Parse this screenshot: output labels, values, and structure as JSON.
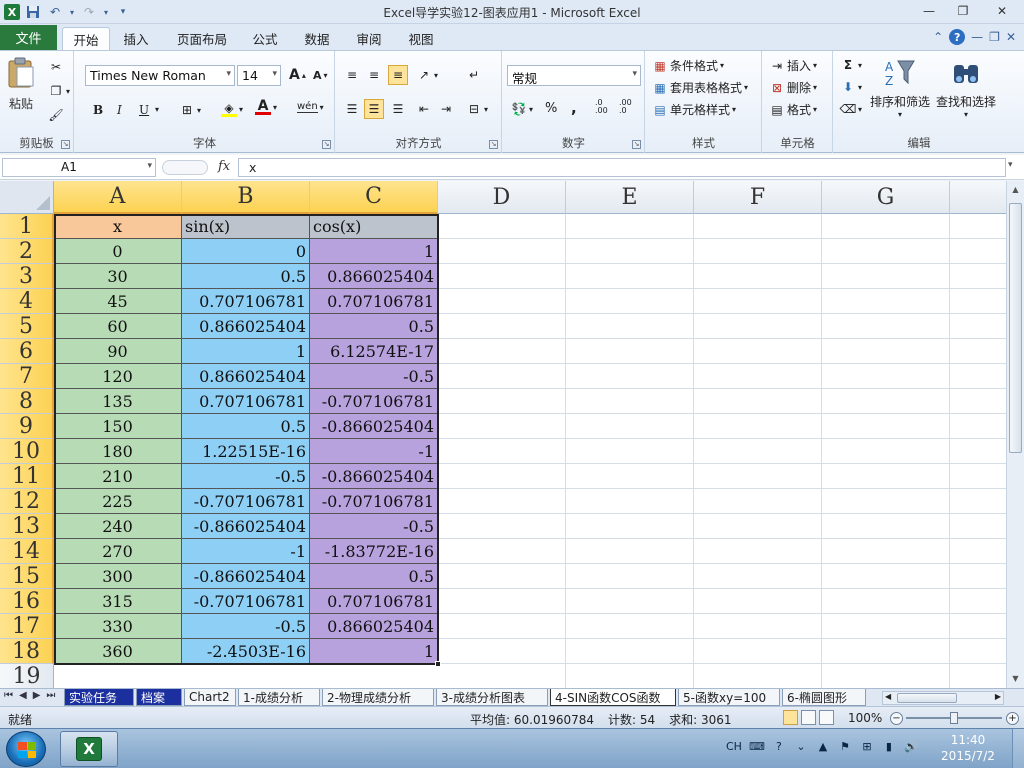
{
  "window": {
    "title": "Excel导学实验12-图表应用1 - Microsoft Excel"
  },
  "ribbon_tabs": {
    "file": "文件",
    "tabs": [
      "开始",
      "插入",
      "页面布局",
      "公式",
      "数据",
      "审阅",
      "视图"
    ],
    "active": "开始"
  },
  "ribbon": {
    "clipboard": {
      "paste": "粘贴",
      "label": "剪贴板"
    },
    "font": {
      "name": "Times New Roman",
      "size": "14",
      "label": "字体",
      "bold": "B",
      "italic": "I",
      "underline": "U",
      "phonetic": "wén"
    },
    "alignment": {
      "label": "对齐方式"
    },
    "number": {
      "format": "常规",
      "label": "数字",
      "percent": "%",
      "comma": ",",
      "inc_decimal": ".0 .00",
      "dec_decimal": ".00 .0"
    },
    "styles": {
      "conditional": "条件格式",
      "table": "套用表格格式",
      "cell_styles": "单元格样式",
      "label": "样式"
    },
    "cells": {
      "insert": "插入",
      "delete": "删除",
      "format": "格式",
      "label": "单元格"
    },
    "editing": {
      "sort_filter": "排序和筛选",
      "find_select": "查找和选择",
      "label": "编辑",
      "sum": "Σ"
    }
  },
  "formula_bar": {
    "name_box": "A1",
    "fx": "fx",
    "value": "x"
  },
  "columns": [
    "A",
    "B",
    "C",
    "D",
    "E",
    "F",
    "G"
  ],
  "rows": [
    "1",
    "2",
    "3",
    "4",
    "5",
    "6",
    "7",
    "8",
    "9",
    "10",
    "11",
    "12",
    "13",
    "14",
    "15",
    "16",
    "17",
    "18",
    "19"
  ],
  "table": {
    "headers": [
      "x",
      "sin(x)",
      "cos(x)"
    ],
    "rows": [
      [
        "0",
        "0",
        "1"
      ],
      [
        "30",
        "0.5",
        "0.866025404"
      ],
      [
        "45",
        "0.707106781",
        "0.707106781"
      ],
      [
        "60",
        "0.866025404",
        "0.5"
      ],
      [
        "90",
        "1",
        "6.12574E-17"
      ],
      [
        "120",
        "0.866025404",
        "-0.5"
      ],
      [
        "135",
        "0.707106781",
        "-0.707106781"
      ],
      [
        "150",
        "0.5",
        "-0.866025404"
      ],
      [
        "180",
        "1.22515E-16",
        "-1"
      ],
      [
        "210",
        "-0.5",
        "-0.866025404"
      ],
      [
        "225",
        "-0.707106781",
        "-0.707106781"
      ],
      [
        "240",
        "-0.866025404",
        "-0.5"
      ],
      [
        "270",
        "-1",
        "-1.83772E-16"
      ],
      [
        "300",
        "-0.866025404",
        "0.5"
      ],
      [
        "315",
        "-0.707106781",
        "0.707106781"
      ],
      [
        "330",
        "-0.5",
        "0.866025404"
      ],
      [
        "360",
        "-2.4503E-16",
        "1"
      ]
    ]
  },
  "sheets": [
    "实验任务",
    "档案",
    "Chart2",
    "1-成绩分析",
    "2-物理成绩分析",
    "3-成绩分析图表",
    "4-SIN函数COS函数",
    "5-函数xy=100",
    "6-椭圆图形"
  ],
  "active_sheet": "4-SIN函数COS函数",
  "status": {
    "mode": "就绪",
    "average": "平均值: 60.01960784",
    "count": "计数: 54",
    "sum": "求和: 3061",
    "zoom": "100%"
  },
  "taskbar": {
    "lang": "CH",
    "time": "11:40",
    "date": "2015/7/2"
  },
  "colors": {
    "col_a": "#b7dcb5",
    "col_b": "#8dcff5",
    "col_c": "#b8a2dd",
    "header_a": "#f8c89b",
    "header_bc": "#bcc3cc",
    "selected_header": "#fcd252",
    "file_tab": "#2b7a3d"
  }
}
